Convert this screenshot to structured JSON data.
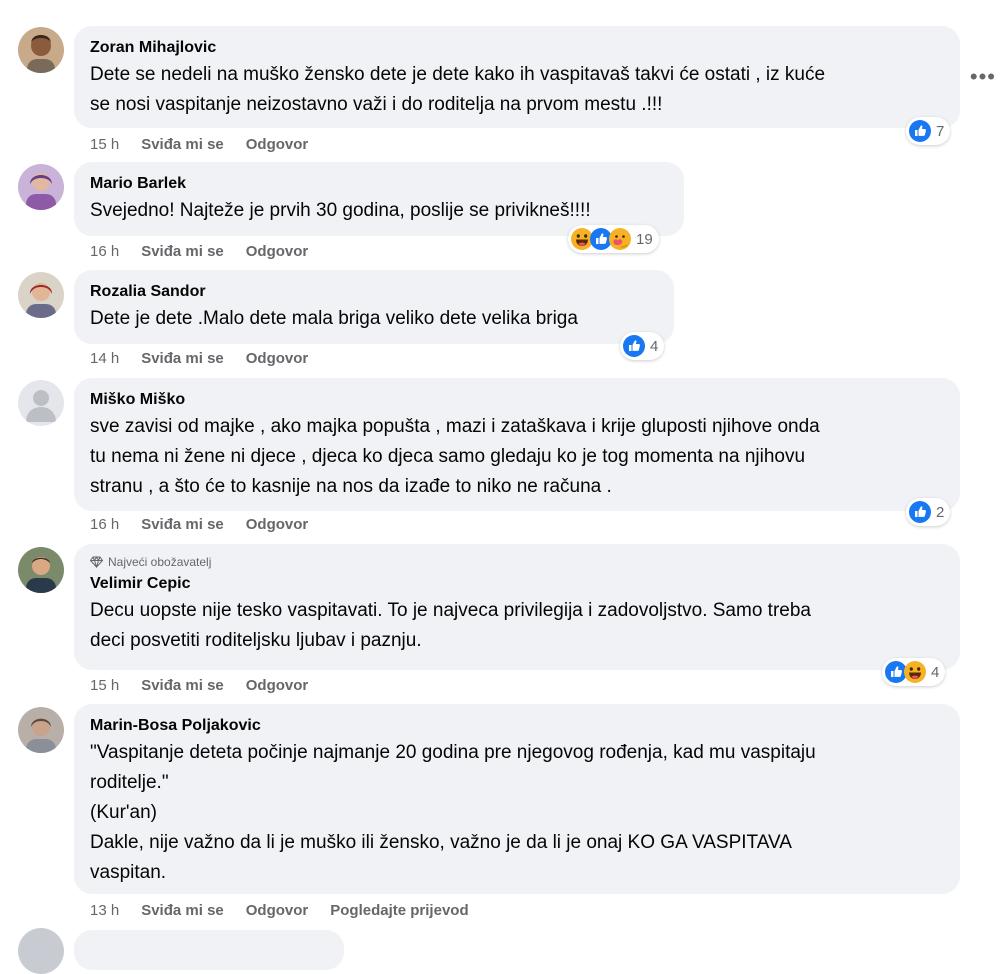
{
  "comments": [
    {
      "author": "Zoran Mihajlovic",
      "text": "Dete se nedeli na muško žensko dete je dete kako ih vaspitavaš takvi će ostati , iz kuće\nse nosi vaspitanje neizostavno važi i do roditelja na prvom mestu .!!!",
      "time": "15 h",
      "like": "Sviđa mi se",
      "reply": "Odgovor",
      "reaction_count": "7",
      "reactions": [
        "like"
      ]
    },
    {
      "author": "Mario Barlek",
      "text": "Svejedno! Najteže je prvih 30 godina, poslije se privikneš!!!!",
      "time": "16 h",
      "like": "Sviđa mi se",
      "reply": "Odgovor",
      "reaction_count": "19",
      "reactions": [
        "haha",
        "like",
        "care"
      ]
    },
    {
      "author": "Rozalia Sandor",
      "text": "Dete je dete .Malo dete mala briga veliko dete velika briga",
      "time": "14 h",
      "like": "Sviđa mi se",
      "reply": "Odgovor",
      "reaction_count": "4",
      "reactions": [
        "like"
      ]
    },
    {
      "author": "Miško Miško",
      "text": "sve zavisi od majke , ako majka popušta , mazi i zataškava i krije gluposti njihove onda\ntu nema ni žene ni djece , djeca ko djeca samo gledaju ko je tog momenta na njihovu\nstranu , a što će to kasnije na nos da izađe to niko ne računa .",
      "time": "16 h",
      "like": "Sviđa mi se",
      "reply": "Odgovor",
      "reaction_count": "2",
      "reactions": [
        "like"
      ]
    },
    {
      "badge": "Najveći obožavatelj",
      "author": "Velimir Cepic",
      "text": "Decu uopste nije tesko vaspitavati. To je najveca privilegija i zadovoljstvo. Samo treba\ndeci posvetiti roditeljsku ljubav i paznju.",
      "time": "15 h",
      "like": "Sviđa mi se",
      "reply": "Odgovor",
      "reaction_count": "4",
      "reactions": [
        "like",
        "haha"
      ]
    },
    {
      "author": "Marin-Bosa Poljakovic",
      "text": "\"Vaspitanje deteta počinje najmanje 20 godina pre njegovog rođenja, kad mu vaspitaju\nroditelje.\"\n(Kur'an)\nDakle, nije važno da li je muško ili žensko, važno je da li je onaj KO GA VASPITAVA\nvaspitan.",
      "time": "13 h",
      "like": "Sviđa mi se",
      "reply": "Odgovor",
      "translate": "Pogledajte prijevod"
    }
  ],
  "icons": {
    "more": "more-horizontal-icon",
    "badge": "diamond-icon",
    "like": "like-reaction-icon",
    "haha": "haha-reaction-icon",
    "care": "care-reaction-icon"
  },
  "colors": {
    "bubble": "#f0f2f5",
    "like_blue": "#1877f2",
    "secondary_text": "#65676b"
  }
}
